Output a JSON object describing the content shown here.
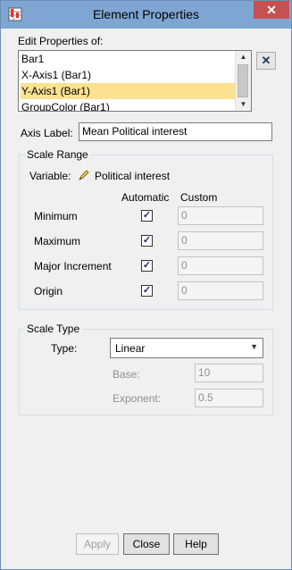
{
  "window": {
    "title": "Element Properties",
    "close_glyph": "✕"
  },
  "edit_properties_label": "Edit Properties of:",
  "elements_list": [
    "Bar1",
    "X-Axis1 (Bar1)",
    "Y-Axis1 (Bar1)",
    "GroupColor (Bar1)"
  ],
  "selected_index": 2,
  "delete_glyph": "✕",
  "axis_label": {
    "label": "Axis Label:",
    "value": "Mean Political interest"
  },
  "scale_range": {
    "legend": "Scale Range",
    "variable_label": "Variable:",
    "variable_value": "Political interest",
    "automatic_header": "Automatic",
    "custom_header": "Custom",
    "rows": [
      {
        "label": "Minimum",
        "automatic": true,
        "custom": "0"
      },
      {
        "label": "Maximum",
        "automatic": true,
        "custom": "0"
      },
      {
        "label": "Major Increment",
        "automatic": true,
        "custom": "0"
      },
      {
        "label": "Origin",
        "automatic": true,
        "custom": "0"
      }
    ]
  },
  "scale_type": {
    "legend": "Scale Type",
    "type_label": "Type:",
    "type_value": "Linear",
    "base_label": "Base:",
    "base_value": "10",
    "exponent_label": "Exponent:",
    "exponent_value": "0.5"
  },
  "buttons": {
    "apply": "Apply",
    "close": "Close",
    "help": "Help"
  },
  "colors": {
    "title_bar": "#7fa6d3",
    "selection": "#fbe291",
    "close_button": "#c75050"
  }
}
